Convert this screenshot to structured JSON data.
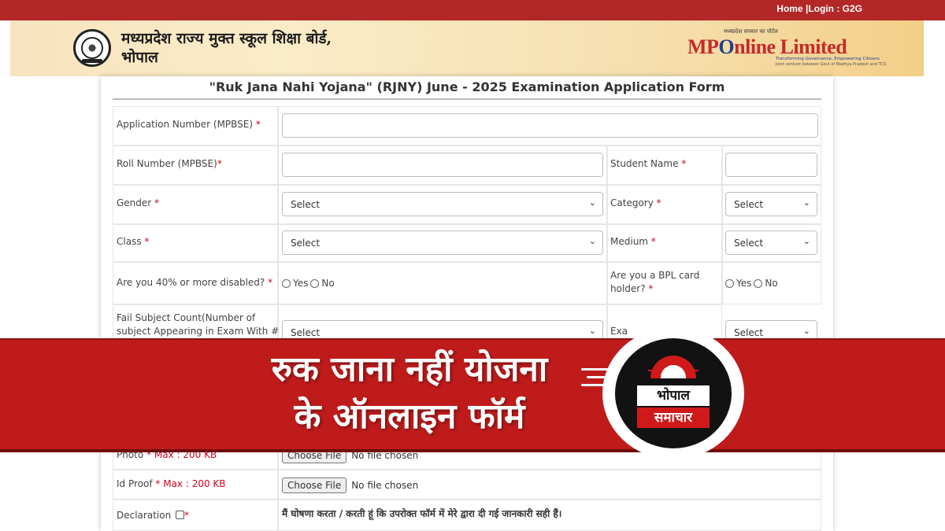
{
  "top_links": "Home |Login : G2G",
  "header": {
    "board_name_line1": "मध्यप्रदेश राज्य मुक्त स्कूल शिक्षा बोर्ड,",
    "board_name_line2": "भोपाल",
    "partner_small": "मध्यप्रदेश सरकार का पोर्टल",
    "partner_logo_mp": "MP",
    "partner_logo_o": "O",
    "partner_logo_rest": "nline Limited",
    "partner_tagline": "Transforming Governance, Empowering Citizens",
    "partner_tagline2": "Joint venture between Govt of Madhya Pradesh and TCS"
  },
  "form": {
    "title": "\"Ruk Jana Nahi Yojana\" (RJNY) June - 2025 Examination Application Form",
    "required_mark": "*",
    "application_number_label": "Application Number (MPBSE) ",
    "roll_number_label": "Roll Number (MPBSE)",
    "student_name_label": "Student Name ",
    "gender_label": "Gender ",
    "category_label": "Category ",
    "class_label": "Class ",
    "medium_label": "Medium ",
    "disabled_label": "Are you 40% or more disabled? ",
    "bpl_label_line1": "Are you a BPL card",
    "bpl_label_line2": "holder? ",
    "yes": "Yes",
    "no": "No",
    "fail_count_line1": "Fail Subject Count(Number of",
    "fail_count_line2": "subject Appearing in Exam With #",
    "exam_label_partial": "Exa",
    "select_placeholder": "Select",
    "photo_label_partial": "Photo",
    "photo_max": "Max : 200 KB",
    "id_proof_label": "Id Proof ",
    "id_proof_max": "Max : 200 KB",
    "choose_file": "Choose File",
    "no_file": "No file chosen",
    "declaration_label": "Declaration ",
    "declaration_text": "मैं घोषणा करता / करती हूं कि उपरोक्त फॉर्म में मेरे द्वारा दी गई जानकारी सही हैं।"
  },
  "overlay": {
    "headline_line1": "रुक जाना नहीं योजना",
    "headline_line2": "के ऑनलाइन फॉर्म",
    "brand_line1": "भोपाल",
    "brand_line2": "समाचार"
  },
  "colors": {
    "topbar": "#b32727",
    "overlay": "#bf1b1b",
    "required": "#d0021b"
  }
}
